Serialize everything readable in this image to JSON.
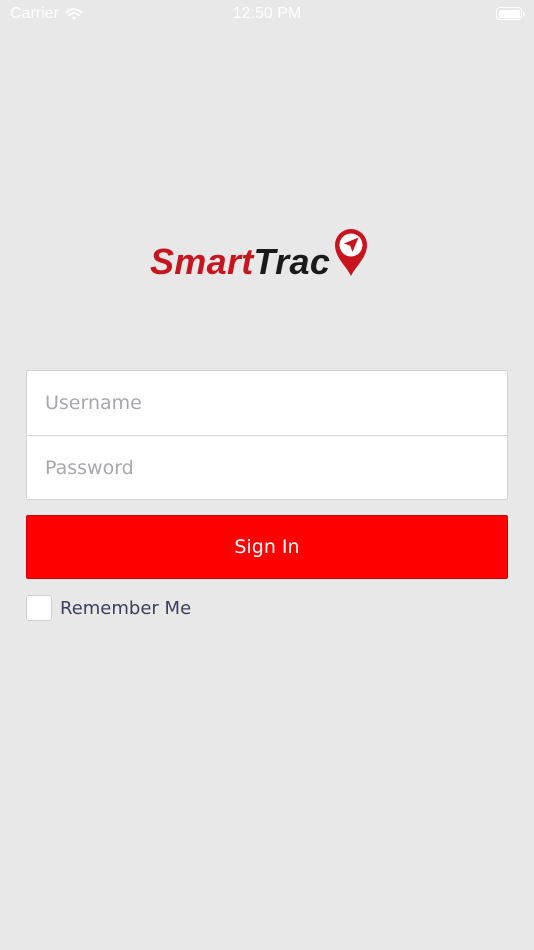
{
  "status_bar": {
    "carrier": "Carrier",
    "time": "12:50 PM",
    "wifi_icon": "wifi-icon",
    "battery_icon": "battery-icon"
  },
  "logo": {
    "smart": "Smart",
    "trac": "Trac",
    "pin_icon": "location-pin-icon",
    "colors": {
      "smart": "#c8141e",
      "trac": "#1a1a1a",
      "pin": "#c8141e"
    }
  },
  "login": {
    "username_placeholder": "Username",
    "password_placeholder": "Password",
    "sign_in_label": "Sign In",
    "remember_me_label": "Remember Me",
    "remember_me_checked": false
  },
  "colors": {
    "background": "#e8e8e8",
    "button": "#ff0000",
    "button_text": "#ffffff",
    "label_text": "#3a3f5c"
  }
}
